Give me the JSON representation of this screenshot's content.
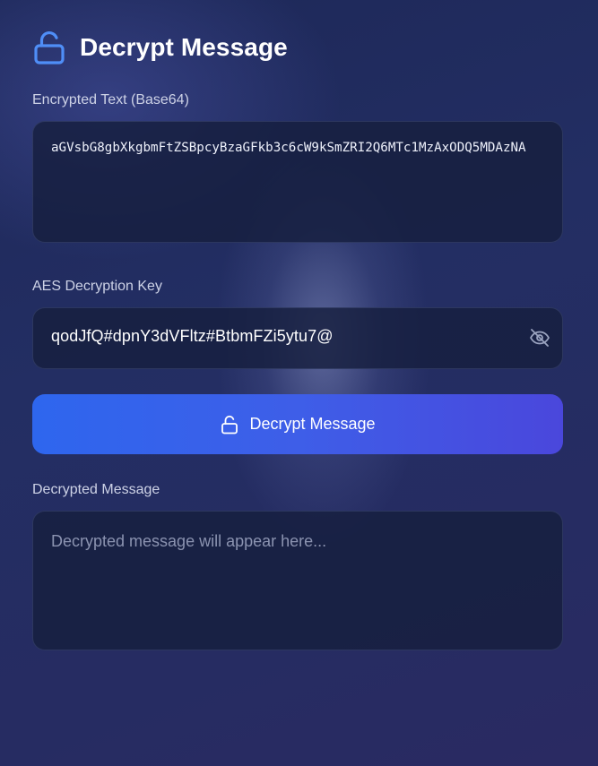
{
  "header": {
    "title": "Decrypt Message",
    "icon": "unlock-icon",
    "accent_color": "#4f8ef7"
  },
  "encrypted": {
    "label": "Encrypted Text (Base64)",
    "value": "aGVsbG8gbXkgbmFtZSBpcyBzaGFkb3c6cW9kSmZRI2Q6MTc1MzAxODQ5MDAzNA"
  },
  "key": {
    "label": "AES Decryption Key",
    "value": "qodJfQ#dpnY3dVFltz#BtbmFZi5ytu7@",
    "toggle_icon": "eye-off-icon"
  },
  "decrypt_button": {
    "label": "Decrypt Message",
    "icon": "unlock-icon",
    "gradient_start": "#2e66ee",
    "gradient_end": "#4a47dc"
  },
  "output": {
    "label": "Decrypted Message",
    "placeholder": "Decrypted message will appear here...",
    "value": ""
  }
}
